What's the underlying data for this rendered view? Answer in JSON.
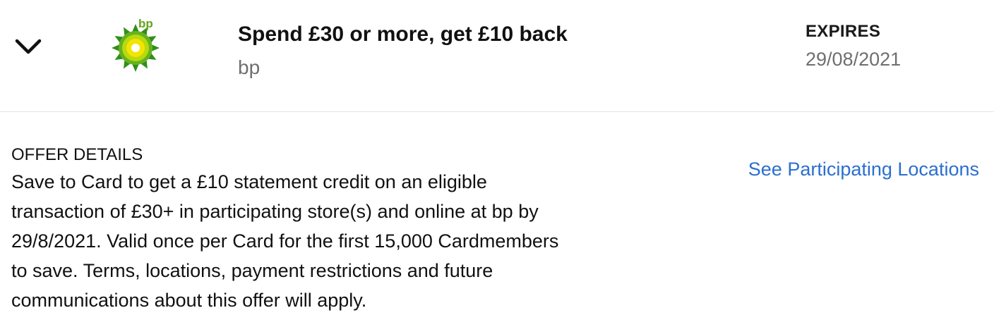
{
  "offer": {
    "title": "Spend £30 or more, get £10 back",
    "merchant": "bp",
    "logo_text": "bp",
    "expires_label": "EXPIRES",
    "expires_date": "29/08/2021"
  },
  "details": {
    "label": "OFFER DETAILS",
    "lines": [
      "Save to Card to get a £10 statement credit on an eligible",
      "transaction of £30+ in participating store(s) and online at bp by",
      "29/8/2021. Valid once per Card for the first 15,000 Cardmembers",
      "to save. Terms, locations, payment restrictions and future",
      "communications about this offer will apply."
    ]
  },
  "links": {
    "locations": "See Participating Locations"
  },
  "icons": {
    "toggle": "chevron-down-icon",
    "brand": "bp-helios-logo"
  },
  "colors": {
    "link": "#2b6fcf",
    "muted_text": "#6f6f6f",
    "bp_green": "#66a31e",
    "bp_yellow": "#f2e500"
  }
}
